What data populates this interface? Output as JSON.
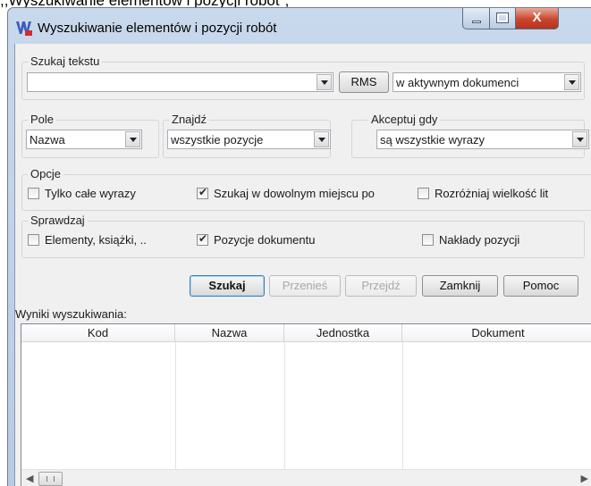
{
  "caption": ",,Wyszukiwanie elementów i pozycji robót\";",
  "window": {
    "title": "Wyszukiwanie elementów i pozycji robót",
    "icon": "app-logo-icon"
  },
  "search": {
    "group_label": "Szukaj tekstu",
    "group_label_accel": "t",
    "text_value": "",
    "rms_button": "RMS",
    "scope_value": "w aktywnym dokumenci"
  },
  "field": {
    "group_label": "Pole",
    "value": "Nazwa"
  },
  "find": {
    "group_label": "Znajdź",
    "value": "wszystkie pozycje"
  },
  "accept": {
    "group_label": "Akceptuj gdy",
    "value": "są wszystkie wyrazy"
  },
  "options": {
    "group_label": "Opcje",
    "items": [
      {
        "label": "Tylko całe wyrazy",
        "checked": false
      },
      {
        "label": "Szukaj w dowolnym miejscu po",
        "checked": true
      },
      {
        "label": "Rozróżniaj wielkość lit",
        "checked": false
      }
    ]
  },
  "check_scope": {
    "group_label": "Sprawdzaj",
    "items": [
      {
        "label": "Elementy, książki, ..",
        "checked": false
      },
      {
        "label": "Pozycje dokumentu",
        "checked": true
      },
      {
        "label": "Nakłady pozycji",
        "checked": false
      }
    ]
  },
  "actions": {
    "search": "Szukaj",
    "transfer": "Przenieś",
    "goto": "Przejdź",
    "close": "Zamknij",
    "help": "Pomoc"
  },
  "results": {
    "label": "Wyniki wyszukiwania:",
    "columns": [
      "Kod",
      "Nazwa",
      "Jednostka",
      "Dokument"
    ],
    "rows": []
  }
}
